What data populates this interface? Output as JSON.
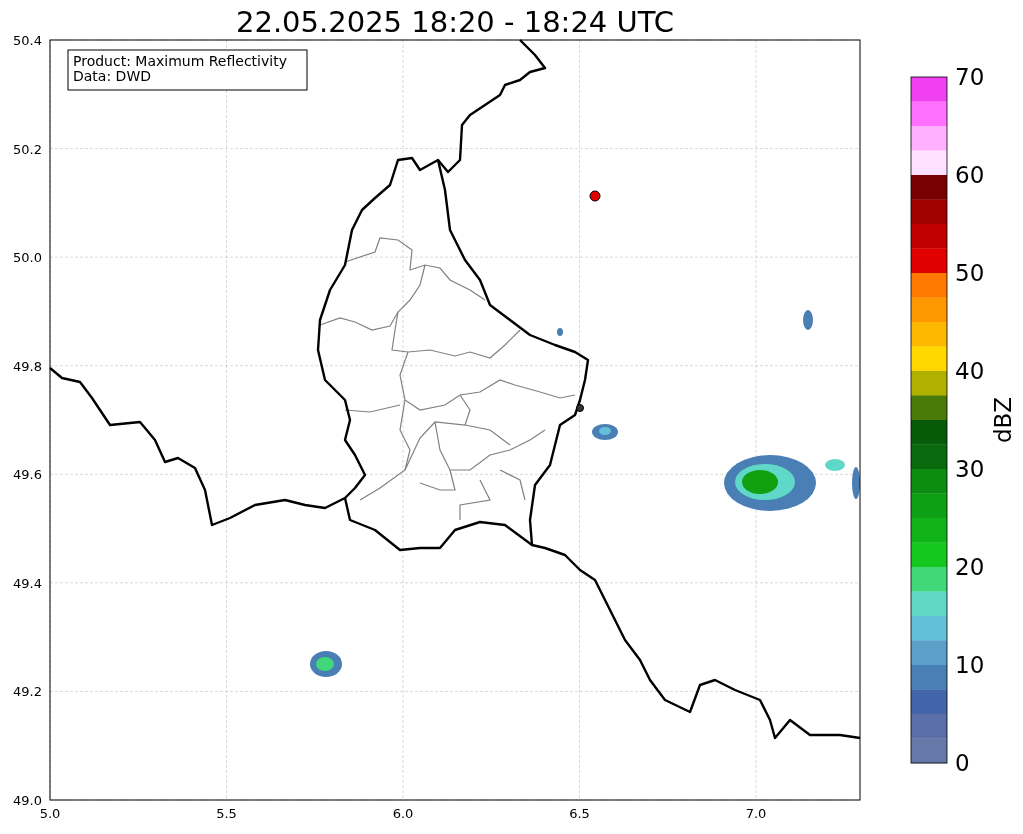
{
  "title": "22.05.2025 18:20 - 18:24 UTC",
  "info_box": [
    "Product: Maximum Reflectivity",
    "Data: DWD"
  ],
  "x_ticks": [
    "5.0",
    "5.5",
    "6.0",
    "6.5",
    "7.0"
  ],
  "y_ticks": [
    "50.4",
    "50.2",
    "50.0",
    "49.8",
    "49.6",
    "49.4",
    "49.2",
    "49.0"
  ],
  "colorbar": {
    "label": "dBZ",
    "ticks": [
      "70",
      "60",
      "50",
      "40",
      "30",
      "20",
      "10",
      "0"
    ],
    "bands": [
      {
        "color": "#f040f0"
      },
      {
        "color": "#ff70ff"
      },
      {
        "color": "#ffb0ff"
      },
      {
        "color": "#ffe0ff"
      },
      {
        "color": "#780000"
      },
      {
        "color": "#a00000"
      },
      {
        "color": "#c00000"
      },
      {
        "color": "#e00000"
      },
      {
        "color": "#ff7800"
      },
      {
        "color": "#ff9800"
      },
      {
        "color": "#ffb800"
      },
      {
        "color": "#ffd800"
      },
      {
        "color": "#b0b000"
      },
      {
        "color": "#4a7a08"
      },
      {
        "color": "#065a08"
      },
      {
        "color": "#086a0c"
      },
      {
        "color": "#0c8c10"
      },
      {
        "color": "#0ea014"
      },
      {
        "color": "#10b418"
      },
      {
        "color": "#14c81e"
      },
      {
        "color": "#40d878"
      },
      {
        "color": "#60d8c8"
      },
      {
        "color": "#62c0d8"
      },
      {
        "color": "#5aa0c8"
      },
      {
        "color": "#4a7fb5"
      },
      {
        "color": "#4264a8"
      },
      {
        "color": "#5a6ea8"
      },
      {
        "color": "#6578a8"
      }
    ]
  }
}
